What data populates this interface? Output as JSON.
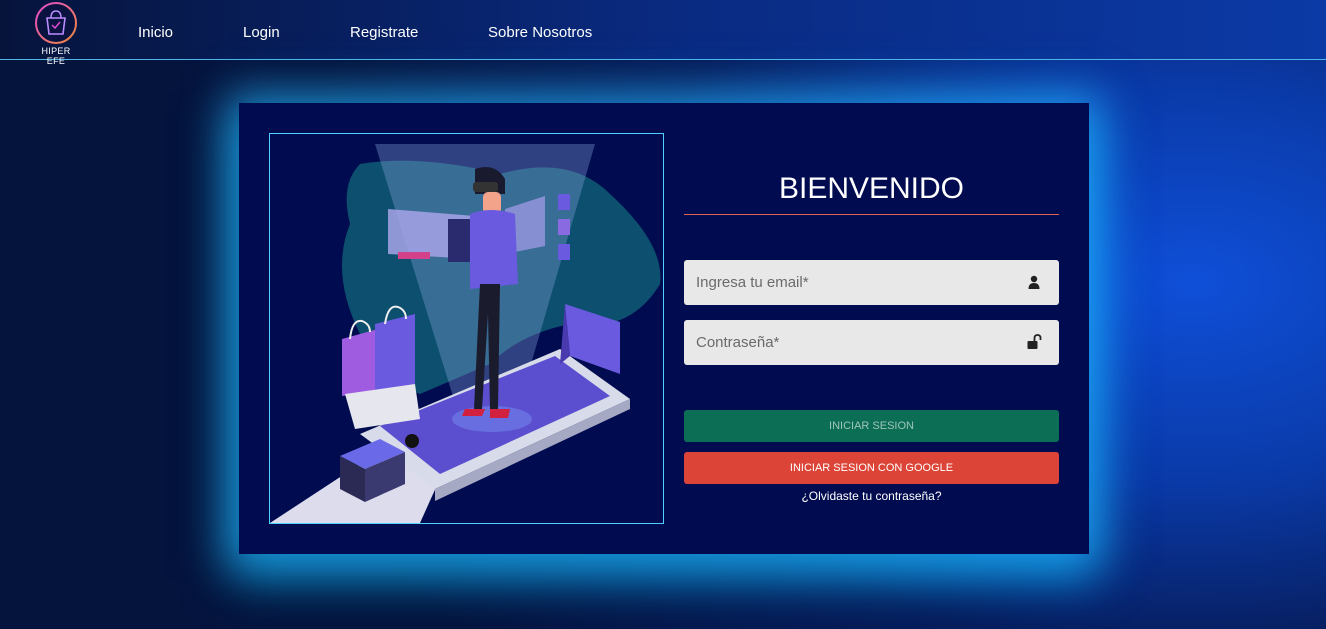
{
  "brand": {
    "name": "HIPER EFE",
    "logo_icon": "shopping-bag-logo-icon"
  },
  "nav": [
    {
      "label": "Inicio"
    },
    {
      "label": "Login"
    },
    {
      "label": "Registrate"
    },
    {
      "label": "Sobre Nosotros"
    }
  ],
  "login": {
    "title": "BIENVENIDO",
    "email": {
      "placeholder": "Ingresa tu email*",
      "icon": "user-icon"
    },
    "password": {
      "placeholder": "Contraseña*",
      "icon": "unlock-icon"
    },
    "login_button": "INICIAR SESION",
    "google_button": "INICIAR SESION CON GOOGLE",
    "forgot": "¿Olvidaste tu contraseña?"
  },
  "colors": {
    "accent_line": "#e0654f",
    "login_button": "#0c6e55",
    "google_button": "#db4437",
    "card_bg": "#000c4f"
  }
}
